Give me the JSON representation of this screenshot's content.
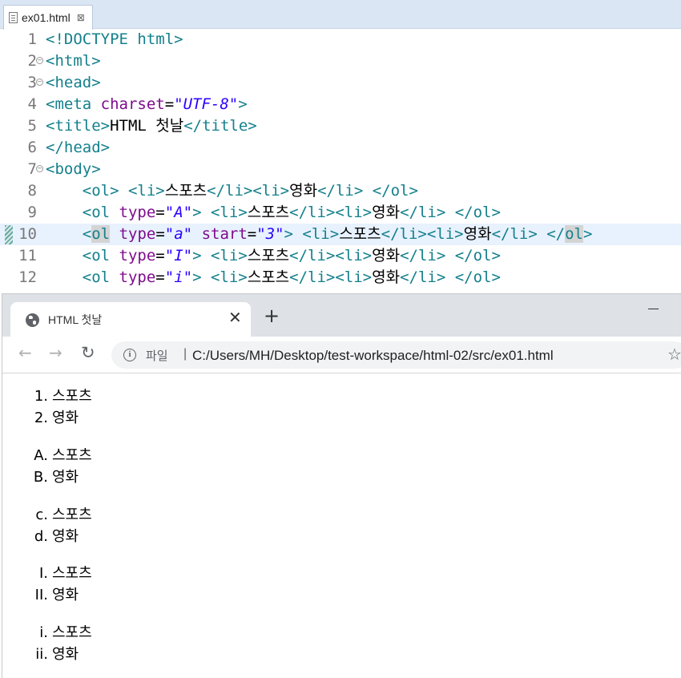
{
  "editor": {
    "tab_label": "ex01.html",
    "tab_close": "⊠",
    "lines": [
      {
        "num": "1",
        "segs": [
          [
            "t",
            "<!DOCTYPE html>"
          ]
        ]
      },
      {
        "num": "2",
        "fold": true,
        "segs": [
          [
            "t",
            "<html>"
          ]
        ]
      },
      {
        "num": "3",
        "fold": true,
        "segs": [
          [
            "t",
            "<head>"
          ]
        ]
      },
      {
        "num": "4",
        "segs": [
          [
            "t",
            "<meta "
          ],
          [
            "a",
            "charset"
          ],
          [
            "",
            "="
          ],
          [
            "v",
            "\"UTF-8\""
          ],
          [
            "t",
            ">"
          ]
        ]
      },
      {
        "num": "5",
        "segs": [
          [
            "t",
            "<title>"
          ],
          [
            "",
            "HTML 첫날"
          ],
          [
            "t",
            "</title>"
          ]
        ]
      },
      {
        "num": "6",
        "segs": [
          [
            "t",
            "</head>"
          ]
        ]
      },
      {
        "num": "7",
        "fold": true,
        "segs": [
          [
            "t",
            "<body>"
          ]
        ]
      },
      {
        "num": "8",
        "segs": [
          [
            "",
            "    "
          ],
          [
            "t",
            "<ol> <li>"
          ],
          [
            "",
            "스포츠"
          ],
          [
            "t",
            "</li><li>"
          ],
          [
            "",
            "영화"
          ],
          [
            "t",
            "</li> </ol>"
          ]
        ]
      },
      {
        "num": "9",
        "segs": [
          [
            "",
            "    "
          ],
          [
            "t",
            "<ol "
          ],
          [
            "a",
            "type"
          ],
          [
            "",
            "="
          ],
          [
            "v",
            "\"A\""
          ],
          [
            "t",
            "> <li>"
          ],
          [
            "",
            "스포츠"
          ],
          [
            "t",
            "</li><li>"
          ],
          [
            "",
            "영화"
          ],
          [
            "t",
            "</li> </ol>"
          ]
        ]
      },
      {
        "num": "10",
        "active": true,
        "segs": [
          [
            "",
            "    "
          ],
          [
            "t",
            "<"
          ],
          [
            "th",
            "ol"
          ],
          [
            "t",
            " "
          ],
          [
            "a",
            "type"
          ],
          [
            "",
            "="
          ],
          [
            "v",
            "\"a\""
          ],
          [
            "t",
            " "
          ],
          [
            "a",
            "start"
          ],
          [
            "",
            "="
          ],
          [
            "v",
            "\"3\""
          ],
          [
            "t",
            "> <li>"
          ],
          [
            "",
            "스포츠"
          ],
          [
            "t",
            "</li><li>"
          ],
          [
            "",
            "영화"
          ],
          [
            "t",
            "</li> </"
          ],
          [
            "th",
            "ol"
          ],
          [
            "t",
            ">"
          ]
        ]
      },
      {
        "num": "11",
        "segs": [
          [
            "",
            "    "
          ],
          [
            "t",
            "<ol "
          ],
          [
            "a",
            "type"
          ],
          [
            "",
            "="
          ],
          [
            "v",
            "\"I\""
          ],
          [
            "t",
            "> <li>"
          ],
          [
            "",
            "스포츠"
          ],
          [
            "t",
            "</li><li>"
          ],
          [
            "",
            "영화"
          ],
          [
            "t",
            "</li> </ol>"
          ]
        ]
      },
      {
        "num": "12",
        "segs": [
          [
            "",
            "    "
          ],
          [
            "t",
            "<ol "
          ],
          [
            "a",
            "type"
          ],
          [
            "",
            "="
          ],
          [
            "v",
            "\"i\""
          ],
          [
            "t",
            "> <li>"
          ],
          [
            "",
            "스포츠"
          ],
          [
            "t",
            "</li><li>"
          ],
          [
            "",
            "영화"
          ],
          [
            "t",
            "</li> </ol>"
          ]
        ]
      }
    ]
  },
  "browser": {
    "tab_title": "HTML 첫날",
    "tab_close": "✕",
    "new_tab": "+",
    "back": "←",
    "forward": "→",
    "reload": "↻",
    "info": "i",
    "security_label": "파일",
    "divider": "|",
    "address": "C:/Users/MH/Desktop/test-workspace/html-02/src/ex01.html",
    "star": "☆"
  },
  "page": {
    "lists": [
      {
        "items": [
          {
            "marker": "1.",
            "text": "스포츠"
          },
          {
            "marker": "2.",
            "text": "영화"
          }
        ]
      },
      {
        "items": [
          {
            "marker": "A.",
            "text": "스포츠"
          },
          {
            "marker": "B.",
            "text": "영화"
          }
        ]
      },
      {
        "items": [
          {
            "marker": "c.",
            "text": "스포츠"
          },
          {
            "marker": "d.",
            "text": "영화"
          }
        ]
      },
      {
        "items": [
          {
            "marker": "I.",
            "text": "스포츠"
          },
          {
            "marker": "II.",
            "text": "영화"
          }
        ]
      },
      {
        "items": [
          {
            "marker": "i.",
            "text": "스포츠"
          },
          {
            "marker": "ii.",
            "text": "영화"
          }
        ]
      }
    ]
  }
}
